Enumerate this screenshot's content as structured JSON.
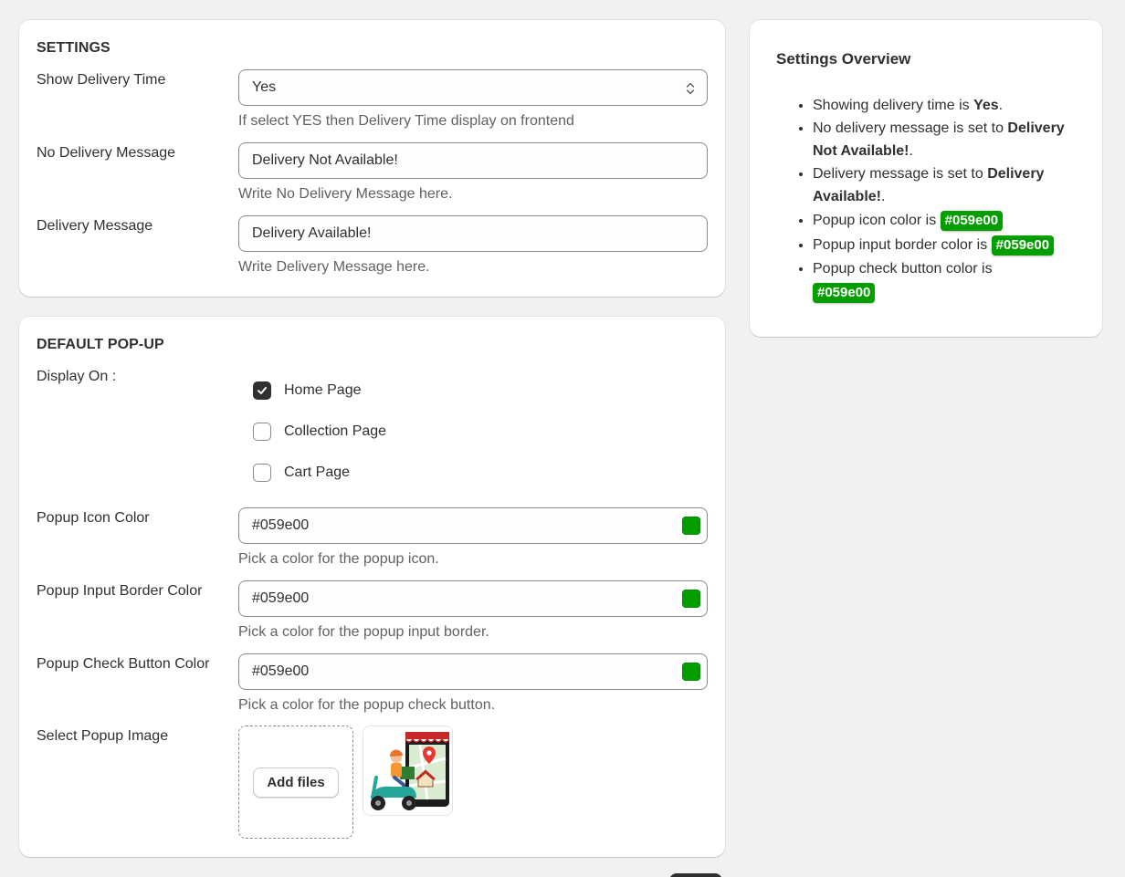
{
  "settings": {
    "title": "SETTINGS",
    "show_delivery_time": {
      "label": "Show Delivery Time",
      "value": "Yes",
      "help": "If select YES then Delivery Time display on frontend"
    },
    "no_delivery_message": {
      "label": "No Delivery Message",
      "value": "Delivery Not Available!",
      "help": "Write No Delivery Message here."
    },
    "delivery_message": {
      "label": "Delivery Message",
      "value": "Delivery Available!",
      "help": "Write Delivery Message here."
    }
  },
  "popup": {
    "title": "DEFAULT POP-UP",
    "display_on_label": "Display On :",
    "display_options": [
      {
        "label": "Home Page",
        "checked": true
      },
      {
        "label": "Collection Page",
        "checked": false
      },
      {
        "label": "Cart Page",
        "checked": false
      }
    ],
    "icon_color": {
      "label": "Popup Icon Color",
      "value": "#059e00",
      "help": "Pick a color for the popup icon."
    },
    "input_border_color": {
      "label": "Popup Input Border Color",
      "value": "#059e00",
      "help": "Pick a color for the popup input border."
    },
    "check_button_color": {
      "label": "Popup Check Button Color",
      "value": "#059e00",
      "help": "Pick a color for the popup check button."
    },
    "image": {
      "label": "Select Popup Image",
      "add_files_label": "Add files",
      "thumbnail_icon": "delivery-scooter-map-icon"
    }
  },
  "overview": {
    "title": "Settings Overview",
    "delivery_time_prefix": "Showing delivery time is ",
    "delivery_time_value": "Yes",
    "no_delivery_prefix": "No delivery message is set to ",
    "no_delivery_value": "Delivery Not Available!",
    "delivery_prefix": "Delivery message is set to ",
    "delivery_value": "Delivery Available!",
    "icon_color_prefix": "Popup icon color is ",
    "icon_color_value": "#059e00",
    "border_color_prefix": "Popup input border color is ",
    "border_color_value": "#059e00",
    "button_color_prefix": "Popup check button color is ",
    "button_color_value": "#059e00",
    "period": "."
  },
  "colors": {
    "accent_green": "#059e00",
    "background": "#f1f1f1"
  }
}
